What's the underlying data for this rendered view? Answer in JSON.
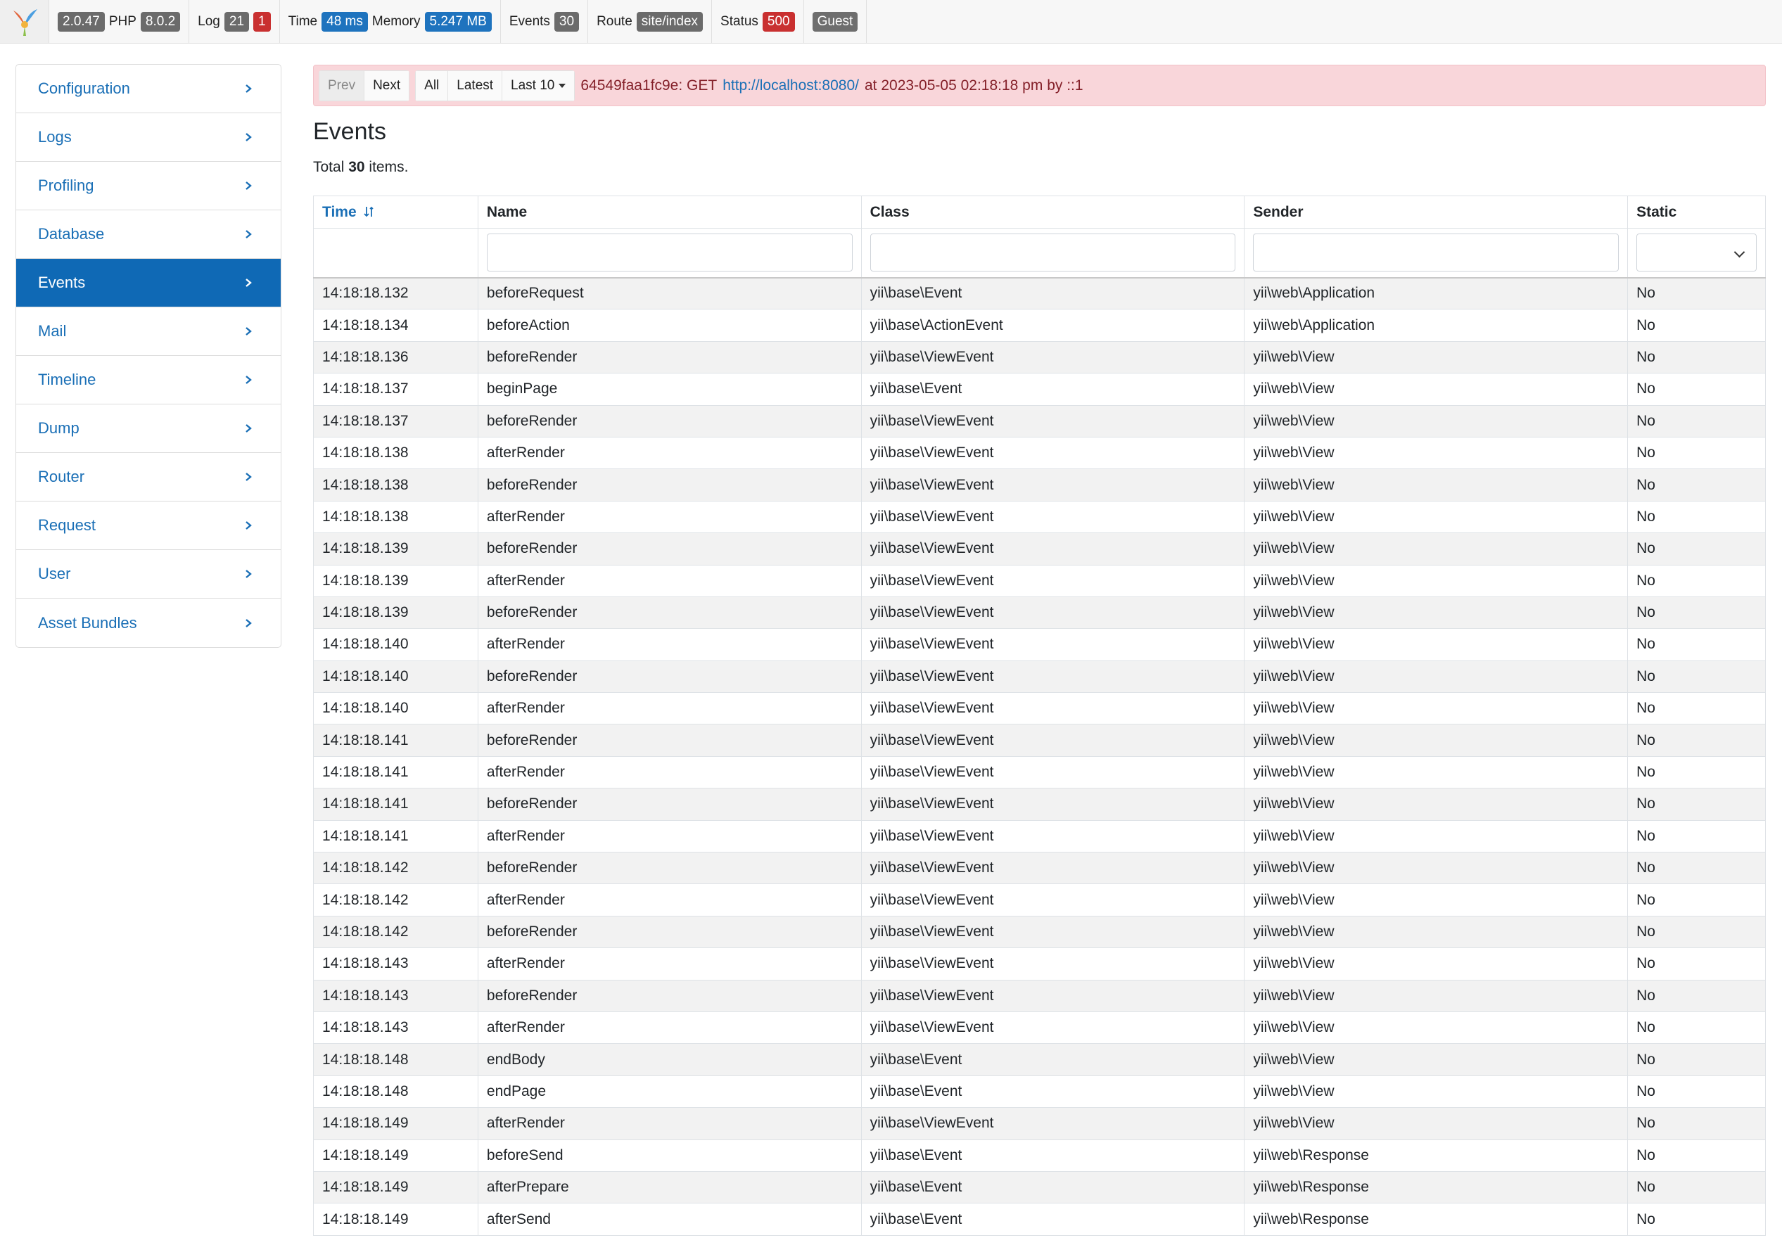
{
  "toolbar": {
    "yii_version": "2.0.47",
    "php_label": "PHP",
    "php_version": "8.0.2",
    "log_label": "Log",
    "log_count": "21",
    "log_errors": "1",
    "time_label": "Time",
    "time_value": "48 ms",
    "memory_label": "Memory",
    "memory_value": "5.247 MB",
    "events_label": "Events",
    "events_count": "30",
    "route_label": "Route",
    "route_value": "site/index",
    "status_label": "Status",
    "status_value": "500",
    "user_value": "Guest"
  },
  "sidebar": {
    "items": [
      {
        "label": "Configuration",
        "active": false
      },
      {
        "label": "Logs",
        "active": false
      },
      {
        "label": "Profiling",
        "active": false
      },
      {
        "label": "Database",
        "active": false
      },
      {
        "label": "Events",
        "active": true
      },
      {
        "label": "Mail",
        "active": false
      },
      {
        "label": "Timeline",
        "active": false
      },
      {
        "label": "Dump",
        "active": false
      },
      {
        "label": "Router",
        "active": false
      },
      {
        "label": "Request",
        "active": false
      },
      {
        "label": "User",
        "active": false
      },
      {
        "label": "Asset Bundles",
        "active": false
      }
    ]
  },
  "request_bar": {
    "prev": "Prev",
    "next": "Next",
    "all": "All",
    "latest": "Latest",
    "last10": "Last 10",
    "tag_prefix": "64549faa1fc9e: GET",
    "url": "http://localhost:8080/",
    "tag_suffix": "at 2023-05-05 02:18:18 pm by ::1"
  },
  "page": {
    "title": "Events",
    "summary_prefix": "Total",
    "summary_count": "30",
    "summary_suffix": "items."
  },
  "table": {
    "columns": [
      "Time",
      "Name",
      "Class",
      "Sender",
      "Static"
    ],
    "rows": [
      [
        "14:18:18.132",
        "beforeRequest",
        "yii\\base\\Event",
        "yii\\web\\Application",
        "No"
      ],
      [
        "14:18:18.134",
        "beforeAction",
        "yii\\base\\ActionEvent",
        "yii\\web\\Application",
        "No"
      ],
      [
        "14:18:18.136",
        "beforeRender",
        "yii\\base\\ViewEvent",
        "yii\\web\\View",
        "No"
      ],
      [
        "14:18:18.137",
        "beginPage",
        "yii\\base\\Event",
        "yii\\web\\View",
        "No"
      ],
      [
        "14:18:18.137",
        "beforeRender",
        "yii\\base\\ViewEvent",
        "yii\\web\\View",
        "No"
      ],
      [
        "14:18:18.138",
        "afterRender",
        "yii\\base\\ViewEvent",
        "yii\\web\\View",
        "No"
      ],
      [
        "14:18:18.138",
        "beforeRender",
        "yii\\base\\ViewEvent",
        "yii\\web\\View",
        "No"
      ],
      [
        "14:18:18.138",
        "afterRender",
        "yii\\base\\ViewEvent",
        "yii\\web\\View",
        "No"
      ],
      [
        "14:18:18.139",
        "beforeRender",
        "yii\\base\\ViewEvent",
        "yii\\web\\View",
        "No"
      ],
      [
        "14:18:18.139",
        "afterRender",
        "yii\\base\\ViewEvent",
        "yii\\web\\View",
        "No"
      ],
      [
        "14:18:18.139",
        "beforeRender",
        "yii\\base\\ViewEvent",
        "yii\\web\\View",
        "No"
      ],
      [
        "14:18:18.140",
        "afterRender",
        "yii\\base\\ViewEvent",
        "yii\\web\\View",
        "No"
      ],
      [
        "14:18:18.140",
        "beforeRender",
        "yii\\base\\ViewEvent",
        "yii\\web\\View",
        "No"
      ],
      [
        "14:18:18.140",
        "afterRender",
        "yii\\base\\ViewEvent",
        "yii\\web\\View",
        "No"
      ],
      [
        "14:18:18.141",
        "beforeRender",
        "yii\\base\\ViewEvent",
        "yii\\web\\View",
        "No"
      ],
      [
        "14:18:18.141",
        "afterRender",
        "yii\\base\\ViewEvent",
        "yii\\web\\View",
        "No"
      ],
      [
        "14:18:18.141",
        "beforeRender",
        "yii\\base\\ViewEvent",
        "yii\\web\\View",
        "No"
      ],
      [
        "14:18:18.141",
        "afterRender",
        "yii\\base\\ViewEvent",
        "yii\\web\\View",
        "No"
      ],
      [
        "14:18:18.142",
        "beforeRender",
        "yii\\base\\ViewEvent",
        "yii\\web\\View",
        "No"
      ],
      [
        "14:18:18.142",
        "afterRender",
        "yii\\base\\ViewEvent",
        "yii\\web\\View",
        "No"
      ],
      [
        "14:18:18.142",
        "beforeRender",
        "yii\\base\\ViewEvent",
        "yii\\web\\View",
        "No"
      ],
      [
        "14:18:18.143",
        "afterRender",
        "yii\\base\\ViewEvent",
        "yii\\web\\View",
        "No"
      ],
      [
        "14:18:18.143",
        "beforeRender",
        "yii\\base\\ViewEvent",
        "yii\\web\\View",
        "No"
      ],
      [
        "14:18:18.143",
        "afterRender",
        "yii\\base\\ViewEvent",
        "yii\\web\\View",
        "No"
      ],
      [
        "14:18:18.148",
        "endBody",
        "yii\\base\\Event",
        "yii\\web\\View",
        "No"
      ],
      [
        "14:18:18.148",
        "endPage",
        "yii\\base\\Event",
        "yii\\web\\View",
        "No"
      ],
      [
        "14:18:18.149",
        "afterRender",
        "yii\\base\\ViewEvent",
        "yii\\web\\View",
        "No"
      ],
      [
        "14:18:18.149",
        "beforeSend",
        "yii\\base\\Event",
        "yii\\web\\Response",
        "No"
      ],
      [
        "14:18:18.149",
        "afterPrepare",
        "yii\\base\\Event",
        "yii\\web\\Response",
        "No"
      ],
      [
        "14:18:18.149",
        "afterSend",
        "yii\\base\\Event",
        "yii\\web\\Response",
        "No"
      ]
    ]
  },
  "colors": {
    "accent": "#0f69b5",
    "link": "#1a6fb6",
    "alert_bg": "#f9d6da",
    "badge_blue": "#1e73be",
    "badge_red": "#c93030"
  }
}
